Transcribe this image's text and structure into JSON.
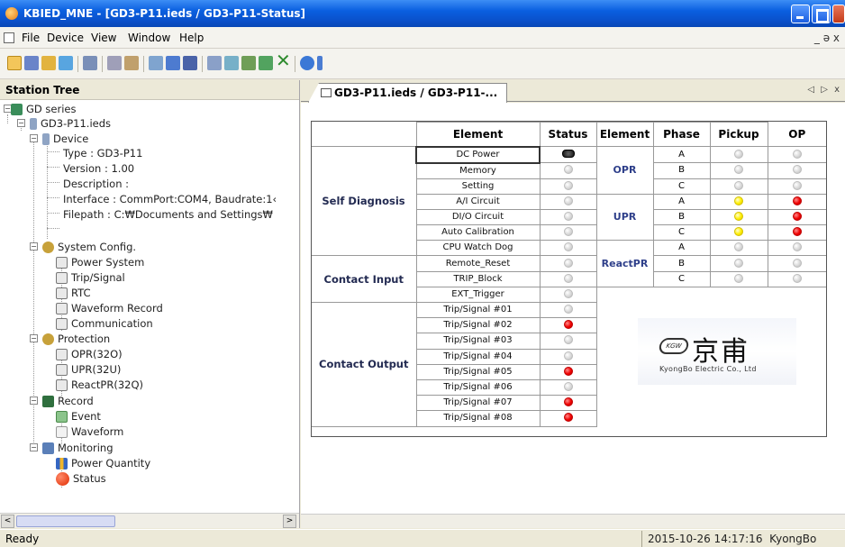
{
  "window": {
    "title": "KBIED_MNE - [GD3-P11.ieds / GD3-P11-Status]"
  },
  "menu": {
    "items": [
      "File",
      "Device",
      "View",
      "Window",
      "Help"
    ],
    "mdi_controls": "_ ə x"
  },
  "left_pane": {
    "title": "Station Tree",
    "tree": {
      "root": "GD series",
      "device_file": "GD3-P11.ieds",
      "device": "Device",
      "type": "Type : GD3-P11",
      "version": "Version : 1.00",
      "description": "Description :",
      "interface": "Interface : CommPort:COM4, Baudrate:1‹",
      "filepath": "Filepath : C:₩Documents and Settings₩",
      "system_config": "System Config.",
      "system_config_items": [
        "Power System",
        "Trip/Signal",
        "RTC",
        "Waveform Record",
        "Communication"
      ],
      "protection": "Protection",
      "protection_items": [
        "OPR(32O)",
        "UPR(32U)",
        "ReactPR(32Q)"
      ],
      "record": "Record",
      "record_items": [
        "Event",
        "Waveform"
      ],
      "monitoring": "Monitoring",
      "monitoring_items": [
        "Power Quantity",
        "Status"
      ]
    }
  },
  "tab": {
    "label": "GD3-P11.ieds / GD3-P11-...",
    "nav": "◁ ▷ x"
  },
  "status_table": {
    "headers": {
      "element": "Element",
      "status": "Status",
      "element2": "Element",
      "phase": "Phase",
      "pickup": "Pickup",
      "op": "OP"
    },
    "groups": {
      "self_diagnosis": "Self Diagnosis",
      "contact_input": "Contact Input",
      "contact_output": "Contact Output",
      "opr": "OPR",
      "upr": "UPR",
      "reactpr": "ReactPR"
    },
    "elements": [
      {
        "name": "DC Power",
        "status": "black"
      },
      {
        "name": "Memory",
        "status": "gray"
      },
      {
        "name": "Setting",
        "status": "gray"
      },
      {
        "name": "A/I Circuit",
        "status": "gray"
      },
      {
        "name": "DI/O Circuit",
        "status": "gray"
      },
      {
        "name": "Auto Calibration",
        "status": "gray"
      },
      {
        "name": "CPU Watch Dog",
        "status": "gray"
      },
      {
        "name": "Remote_Reset",
        "status": "gray"
      },
      {
        "name": "TRIP_Block",
        "status": "gray"
      },
      {
        "name": "EXT_Trigger",
        "status": "gray"
      },
      {
        "name": "Trip/Signal #01",
        "status": "gray"
      },
      {
        "name": "Trip/Signal #02",
        "status": "red"
      },
      {
        "name": "Trip/Signal #03",
        "status": "gray"
      },
      {
        "name": "Trip/Signal #04",
        "status": "gray"
      },
      {
        "name": "Trip/Signal #05",
        "status": "red"
      },
      {
        "name": "Trip/Signal #06",
        "status": "gray"
      },
      {
        "name": "Trip/Signal #07",
        "status": "red"
      },
      {
        "name": "Trip/Signal #08",
        "status": "red"
      }
    ],
    "protection_rows": [
      {
        "phase": "A",
        "pickup": "gray",
        "op": "gray"
      },
      {
        "phase": "B",
        "pickup": "gray",
        "op": "gray"
      },
      {
        "phase": "C",
        "pickup": "gray",
        "op": "gray"
      },
      {
        "phase": "A",
        "pickup": "yellow",
        "op": "red"
      },
      {
        "phase": "B",
        "pickup": "yellow",
        "op": "red"
      },
      {
        "phase": "C",
        "pickup": "yellow",
        "op": "red"
      },
      {
        "phase": "A",
        "pickup": "gray",
        "op": "gray"
      },
      {
        "phase": "B",
        "pickup": "gray",
        "op": "gray"
      },
      {
        "phase": "C",
        "pickup": "gray",
        "op": "gray"
      }
    ]
  },
  "logo": {
    "mark": "KGW",
    "hanja": "京甫",
    "company": "KyongBo Electric Co., Ltd"
  },
  "statusbar": {
    "left": "Ready",
    "datetime": "2015-10-26 14:17:16",
    "user": "KyongBo"
  },
  "colors": {
    "titlebar": "#0a5fe0",
    "led_red": "#f00000",
    "led_yellow": "#ffee00",
    "led_gray": "#d5d5d5",
    "group_text": "#2e3f8a"
  }
}
